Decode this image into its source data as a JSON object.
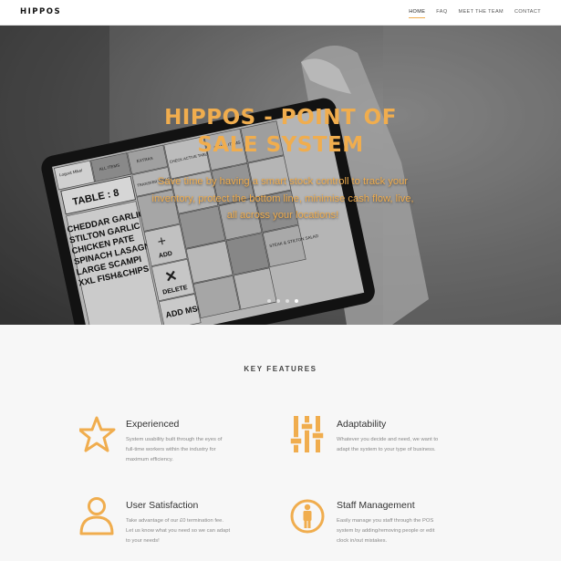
{
  "navbar": {
    "brand": "HIPPOS",
    "items": [
      {
        "label": "HOME",
        "active": true
      },
      {
        "label": "FAQ",
        "active": false
      },
      {
        "label": "MEET THE TEAM",
        "active": false
      },
      {
        "label": "CONTACT",
        "active": false
      }
    ]
  },
  "hero": {
    "title_line1": "HIPPOS - POINT OF",
    "title_line2": "SALE SYSTEM",
    "subtitle": "Save time by having a smart stock controll to track your inventory, protect the bottom line, minimise cash flow, live, all across your locations!",
    "slide_count": 4,
    "active_slide": 4,
    "screen": {
      "table_label": "TABLE : 8",
      "order_lines": [
        "CHEDDAR GARLIC BREAD",
        "STILTON GARLIC BREAD",
        "CHICKEN PATE",
        "SPINACH LASAGNE",
        "LARGE SCAMPI",
        "XXL FISH&CHIPS"
      ],
      "top_buttons": [
        "Logout Mikel",
        "ALL ITEMS",
        "EXTRAS",
        "CHECK ACTIVE TABLES",
        "SMALL ITEMS",
        "TRANSFER TABLE"
      ],
      "add_label": "ADD",
      "delete_label": "DELETE",
      "addmsg_label": "ADD MSG",
      "steak_label": "STEAK & STILTON SALAD"
    }
  },
  "features": {
    "heading": "KEY FEATURES",
    "accent": "#f0ad4e",
    "items": [
      {
        "icon": "star-icon",
        "title": "Experienced",
        "description": "System usability built through the eyes of full-time workers within the industry for maximum efficiency."
      },
      {
        "icon": "sliders-icon",
        "title": "Adaptability",
        "description": "Whatever you decide and need, we want to adapt the system to your type of business."
      },
      {
        "icon": "user-icon",
        "title": "User Satisfaction",
        "description": "Take advantage of our £0 termination fee. Let us know what you need so we can adapt to your needs!"
      },
      {
        "icon": "person-circle-icon",
        "title": "Staff Management",
        "description": "Easily manage you staff through the POS system by adding/removing people or edit clock in/out mistakes."
      }
    ]
  }
}
